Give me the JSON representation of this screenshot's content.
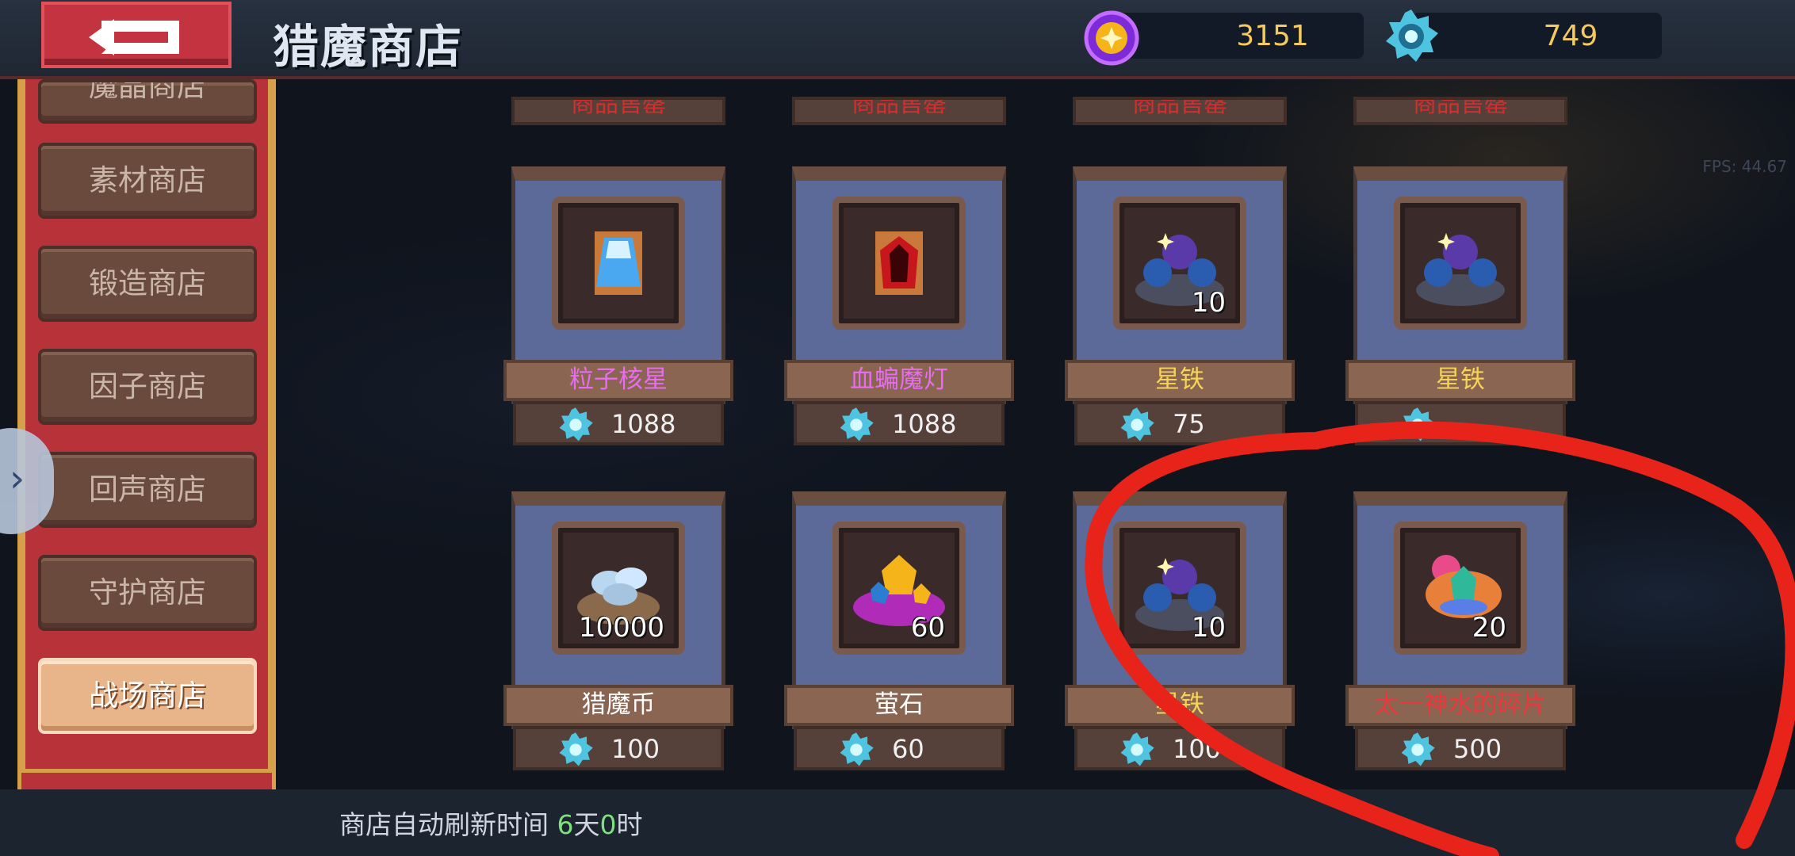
{
  "header": {
    "title": "猎魔商店",
    "currency_gold": "3151",
    "currency_crystal": "749"
  },
  "sidebar": {
    "items": [
      {
        "label": "魔晶商店"
      },
      {
        "label": "素材商店"
      },
      {
        "label": "锻造商店"
      },
      {
        "label": "因子商店"
      },
      {
        "label": "回声商店"
      },
      {
        "label": "守护商店"
      },
      {
        "label": "战场商店"
      }
    ],
    "active": "战场商店"
  },
  "shop": {
    "partial_labels": [
      "商品售罄",
      "商品售罄",
      "商品售罄",
      "商品售罄"
    ],
    "items": [
      {
        "name": "粒子核星",
        "price": "1088",
        "qty": "",
        "icon": "particle-core-icon"
      },
      {
        "name": "血蝙魔灯",
        "price": "1088",
        "qty": "",
        "icon": "blood-bat-lamp-icon"
      },
      {
        "name": "星铁",
        "price": "75",
        "qty": "10",
        "icon": "star-iron-icon"
      },
      {
        "name": "星铁",
        "price": "",
        "qty": "",
        "icon": "star-iron-icon"
      },
      {
        "name": "猎魔币",
        "price": "100",
        "qty": "10000",
        "icon": "hunter-coin-icon"
      },
      {
        "name": "萤石",
        "price": "60",
        "qty": "60",
        "icon": "fluorite-icon"
      },
      {
        "name": "星铁",
        "price": "100",
        "qty": "10",
        "icon": "star-iron-icon"
      },
      {
        "name": "太一神水的碎片",
        "price": "500",
        "qty": "20",
        "icon": "divine-water-fragment-icon"
      }
    ]
  },
  "footer": {
    "refresh_label": "商店自动刷新时间",
    "refresh_days": "6",
    "refresh_days_unit": "天",
    "refresh_hours": "0",
    "refresh_hours_unit": "时"
  },
  "fps": "FPS: 44.67",
  "colors": {
    "gold": "#f4c95d",
    "purple_name": "#e86cf0",
    "red_name": "#e8383c",
    "annotation": "#e8231a"
  }
}
